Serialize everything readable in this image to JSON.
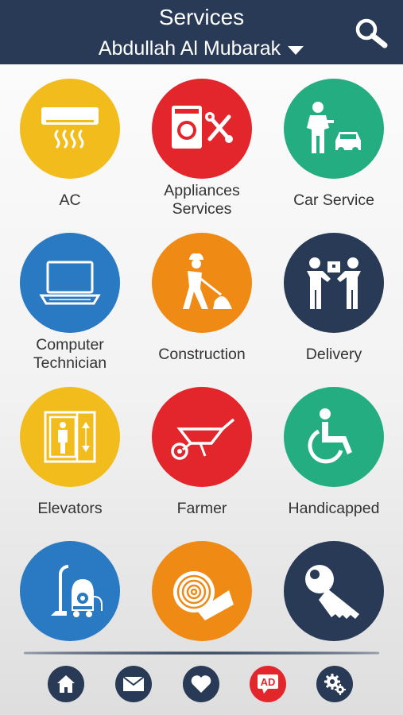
{
  "header": {
    "title": "Services",
    "city": "Abdullah Al Mubarak"
  },
  "services": [
    {
      "label": "AC",
      "icon": "air-conditioner-icon",
      "color": "#f2bd1c"
    },
    {
      "label": "Appliances Services",
      "icon": "washing-machine-tools-icon",
      "color": "#e3262c"
    },
    {
      "label": "Car Service",
      "icon": "mechanic-car-icon",
      "color": "#25ad82"
    },
    {
      "label": "Computer Technician",
      "icon": "laptop-icon",
      "color": "#2979c3"
    },
    {
      "label": "Construction",
      "icon": "construction-worker-icon",
      "color": "#ef8a14"
    },
    {
      "label": "Delivery",
      "icon": "delivery-people-icon",
      "color": "#283a55"
    },
    {
      "label": "Elevators",
      "icon": "elevator-icon",
      "color": "#f2bd1c"
    },
    {
      "label": "Farmer",
      "icon": "wheelbarrow-icon",
      "color": "#e3262c"
    },
    {
      "label": "Handicapped",
      "icon": "wheelchair-icon",
      "color": "#25ad82"
    },
    {
      "label": "",
      "icon": "vacuum-cleaner-icon",
      "color": "#2979c3"
    },
    {
      "label": "",
      "icon": "carpet-roll-icon",
      "color": "#ef8a14"
    },
    {
      "label": "",
      "icon": "key-icon",
      "color": "#283a55"
    }
  ],
  "bottom_nav": [
    {
      "icon": "home-icon",
      "color": "#283a55"
    },
    {
      "icon": "mail-icon",
      "color": "#283a55"
    },
    {
      "icon": "heart-icon",
      "color": "#283a55"
    },
    {
      "icon": "ad-icon",
      "text": "AD",
      "color": "#e3262c"
    },
    {
      "icon": "settings-gears-icon",
      "color": "#283a55"
    }
  ]
}
